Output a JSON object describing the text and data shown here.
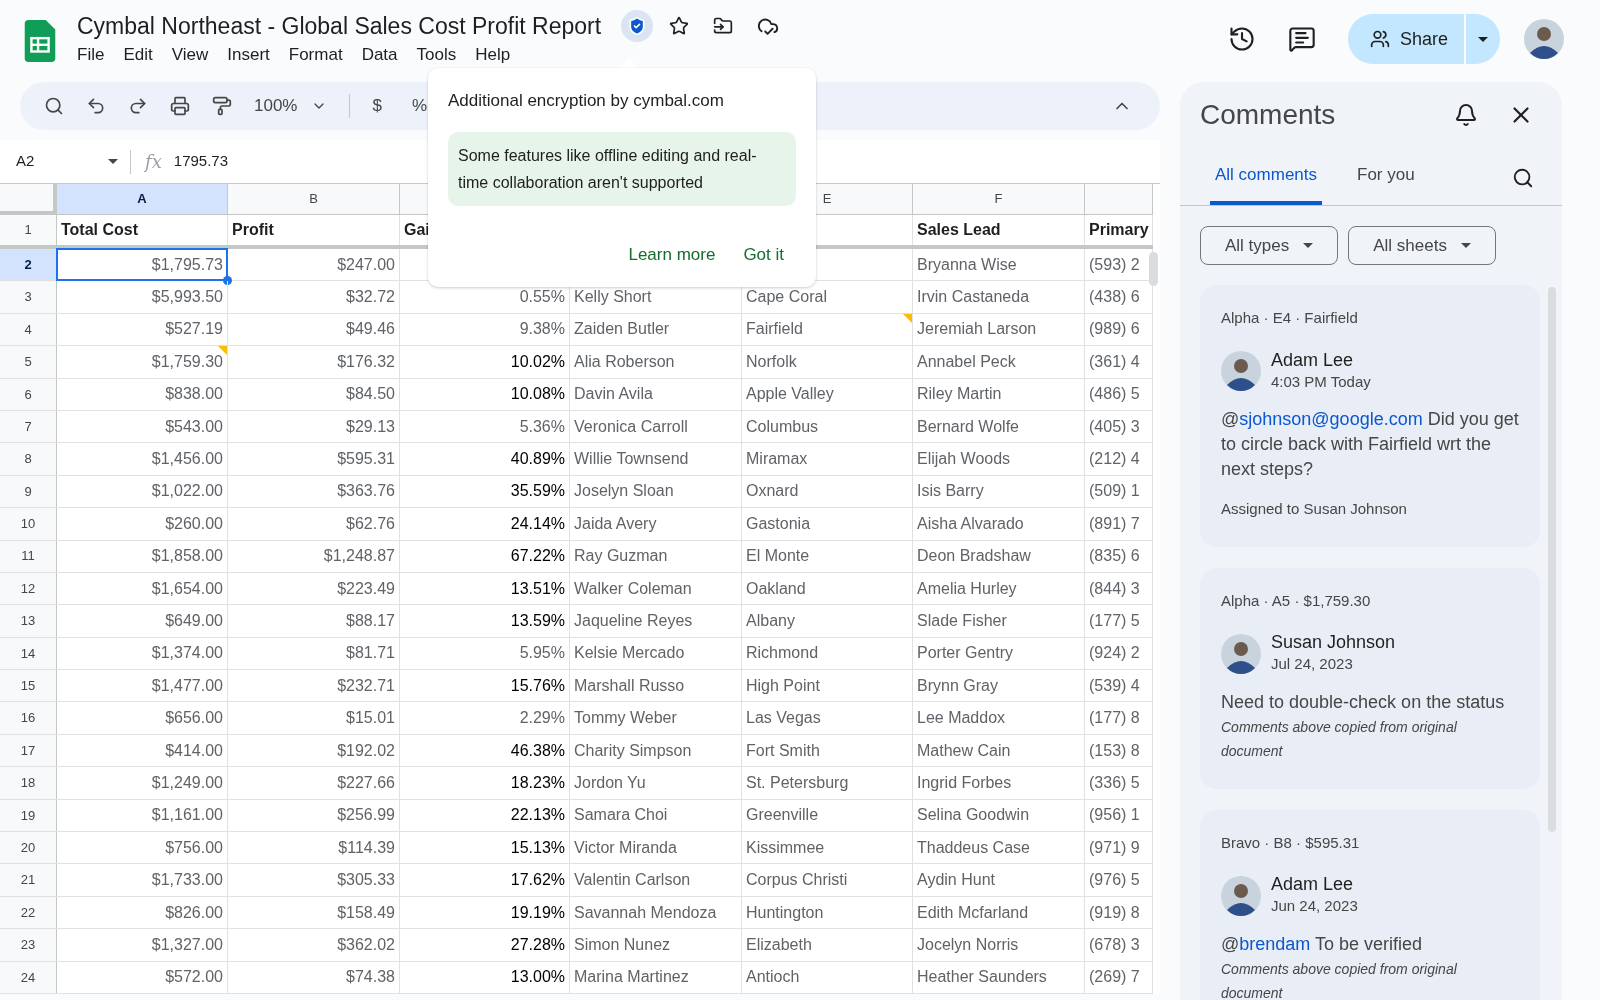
{
  "doc": {
    "title": "Cymbal Northeast - Global Sales Cost Profit Report",
    "menu": [
      "File",
      "Edit",
      "View",
      "Insert",
      "Format",
      "Data",
      "Tools",
      "Help"
    ]
  },
  "toolbar": {
    "zoom": "100%",
    "currency": "$",
    "percent": "%"
  },
  "formula_bar": {
    "cell": "A2",
    "fx": "fx",
    "value": "1795.73"
  },
  "popup": {
    "title": "Additional encryption by cymbal.com",
    "notice": "Some features like offline editing and real-time collaboration aren't supported",
    "actions": [
      "Learn more",
      "Got it"
    ]
  },
  "share": {
    "label": "Share"
  },
  "columns": [
    {
      "letter": "A",
      "selected": true
    },
    {
      "letter": "B",
      "selected": false
    },
    null,
    null,
    {
      "letter": "E",
      "selected": false
    },
    {
      "letter": "F",
      "selected": false
    },
    null
  ],
  "header_row": {
    "num": "1",
    "cells": [
      "Total Cost",
      "Profit",
      "Gai",
      null,
      null,
      "Sales Lead",
      "Primary"
    ]
  },
  "rows": [
    {
      "num": "2",
      "selected": true,
      "dark": false,
      "note_a": false,
      "note_e": false,
      "cells": [
        "$1,795.73",
        "$247.00",
        null,
        null,
        null,
        "Bryanna Wise",
        "(593) 2"
      ]
    },
    {
      "num": "3",
      "selected": false,
      "dark": false,
      "note_a": false,
      "note_e": false,
      "cells": [
        "$5,993.50",
        "$32.72",
        "0.55%",
        "Kelly Short",
        "Cape Coral",
        "Irvin Castaneda",
        "(438) 6"
      ]
    },
    {
      "num": "4",
      "selected": false,
      "dark": false,
      "note_a": false,
      "note_e": true,
      "cells": [
        "$527.19",
        "$49.46",
        "9.38%",
        "Zaiden Butler",
        "Fairfield",
        "Jeremiah Larson",
        "(989) 6"
      ]
    },
    {
      "num": "5",
      "selected": false,
      "dark": true,
      "note_a": true,
      "note_e": false,
      "cells": [
        "$1,759.30",
        "$176.32",
        "10.02%",
        "Alia Roberson",
        "Norfolk",
        "Annabel Peck",
        "(361) 4"
      ]
    },
    {
      "num": "6",
      "selected": false,
      "dark": true,
      "note_a": false,
      "note_e": false,
      "cells": [
        "$838.00",
        "$84.50",
        "10.08%",
        "Davin Avila",
        "Apple Valley",
        "Riley Martin",
        "(486) 5"
      ]
    },
    {
      "num": "7",
      "selected": false,
      "dark": false,
      "note_a": false,
      "note_e": false,
      "cells": [
        "$543.00",
        "$29.13",
        "5.36%",
        "Veronica Carroll",
        "Columbus",
        "Bernard Wolfe",
        "(405) 3"
      ]
    },
    {
      "num": "8",
      "selected": false,
      "dark": true,
      "note_a": false,
      "note_e": false,
      "cells": [
        "$1,456.00",
        "$595.31",
        "40.89%",
        "Willie Townsend",
        "Miramax",
        "Elijah Woods",
        "(212) 4"
      ]
    },
    {
      "num": "9",
      "selected": false,
      "dark": true,
      "note_a": false,
      "note_e": false,
      "cells": [
        "$1,022.00",
        "$363.76",
        "35.59%",
        "Joselyn Sloan",
        "Oxnard",
        "Isis Barry",
        "(509) 1"
      ]
    },
    {
      "num": "10",
      "selected": false,
      "dark": true,
      "note_a": false,
      "note_e": false,
      "cells": [
        "$260.00",
        "$62.76",
        "24.14%",
        "Jaida Avery",
        "Gastonia",
        "Aisha Alvarado",
        "(891) 7"
      ]
    },
    {
      "num": "11",
      "selected": false,
      "dark": true,
      "note_a": false,
      "note_e": false,
      "cells": [
        "$1,858.00",
        "$1,248.87",
        "67.22%",
        "Ray Guzman",
        "El Monte",
        "Deon Bradshaw",
        "(835) 6"
      ]
    },
    {
      "num": "12",
      "selected": false,
      "dark": true,
      "note_a": false,
      "note_e": false,
      "cells": [
        "$1,654.00",
        "$223.49",
        "13.51%",
        "Walker Coleman",
        "Oakland",
        "Amelia Hurley",
        "(844) 3"
      ]
    },
    {
      "num": "13",
      "selected": false,
      "dark": true,
      "note_a": false,
      "note_e": false,
      "cells": [
        "$649.00",
        "$88.17",
        "13.59%",
        "Jaqueline Reyes",
        "Albany",
        "Slade Fisher",
        "(177) 5"
      ]
    },
    {
      "num": "14",
      "selected": false,
      "dark": false,
      "note_a": false,
      "note_e": false,
      "cells": [
        "$1,374.00",
        "$81.71",
        "5.95%",
        "Kelsie Mercado",
        "Richmond",
        "Porter Gentry",
        "(924) 2"
      ]
    },
    {
      "num": "15",
      "selected": false,
      "dark": true,
      "note_a": false,
      "note_e": false,
      "cells": [
        "$1,477.00",
        "$232.71",
        "15.76%",
        "Marshall Russo",
        "High Point",
        "Brynn Gray",
        "(539) 4"
      ]
    },
    {
      "num": "16",
      "selected": false,
      "dark": false,
      "note_a": false,
      "note_e": false,
      "cells": [
        "$656.00",
        "$15.01",
        "2.29%",
        "Tommy Weber",
        "Las Vegas",
        "Lee Maddox",
        "(177) 8"
      ]
    },
    {
      "num": "17",
      "selected": false,
      "dark": true,
      "note_a": false,
      "note_e": false,
      "cells": [
        "$414.00",
        "$192.02",
        "46.38%",
        "Charity Simpson",
        "Fort Smith",
        "Mathew Cain",
        "(153) 8"
      ]
    },
    {
      "num": "18",
      "selected": false,
      "dark": true,
      "note_a": false,
      "note_e": false,
      "cells": [
        "$1,249.00",
        "$227.66",
        "18.23%",
        "Jordon Yu",
        "St. Petersburg",
        "Ingrid Forbes",
        "(336) 5"
      ]
    },
    {
      "num": "19",
      "selected": false,
      "dark": true,
      "note_a": false,
      "note_e": false,
      "cells": [
        "$1,161.00",
        "$256.99",
        "22.13%",
        "Samara Choi",
        "Greenville",
        "Selina Goodwin",
        "(956) 1"
      ]
    },
    {
      "num": "20",
      "selected": false,
      "dark": true,
      "note_a": false,
      "note_e": false,
      "cells": [
        "$756.00",
        "$114.39",
        "15.13%",
        "Victor Miranda",
        "Kissimmee",
        "Thaddeus Case",
        "(971) 9"
      ]
    },
    {
      "num": "21",
      "selected": false,
      "dark": true,
      "note_a": false,
      "note_e": false,
      "cells": [
        "$1,733.00",
        "$305.33",
        "17.62%",
        "Valentin Carlson",
        "Corpus Christi",
        "Aydin Hunt",
        "(976) 5"
      ]
    },
    {
      "num": "22",
      "selected": false,
      "dark": true,
      "note_a": false,
      "note_e": false,
      "cells": [
        "$826.00",
        "$158.49",
        "19.19%",
        "Savannah Mendoza",
        "Huntington",
        "Edith Mcfarland",
        "(919) 8"
      ]
    },
    {
      "num": "23",
      "selected": false,
      "dark": true,
      "note_a": false,
      "note_e": false,
      "cells": [
        "$1,327.00",
        "$362.02",
        "27.28%",
        "Simon Nunez",
        "Elizabeth",
        "Jocelyn Norris",
        "(678) 3"
      ]
    },
    {
      "num": "24",
      "selected": false,
      "dark": true,
      "note_a": false,
      "note_e": false,
      "cells": [
        "$572.00",
        "$74.38",
        "13.00%",
        "Marina Martinez",
        "Antioch",
        "Heather Saunders",
        "(269) 7"
      ]
    }
  ],
  "comments_panel": {
    "title": "Comments",
    "tabs": [
      {
        "label": "All comments",
        "selected": true
      },
      {
        "label": "For you",
        "selected": false
      }
    ],
    "filters": [
      "All types",
      "All sheets"
    ],
    "cards": [
      {
        "context": "Alpha · E4 · Fairfield",
        "author": "Adam Lee",
        "time": "4:03 PM Today",
        "prefix": "@",
        "mention": "sjohnson@google.com",
        "text": " Did you get to circle back with Fairfield wrt the next steps?",
        "footer": "Assigned to Susan Johnson",
        "kind": "assigned"
      },
      {
        "context": "Alpha · A5 · $1,759.30",
        "author": "Susan Johnson",
        "time": "Jul 24, 2023",
        "text": "Need to double-check on the status",
        "footer": "Comments above copied from original document",
        "kind": "copied"
      },
      {
        "context": "Bravo · B8 · $595.31",
        "author": "Adam Lee",
        "time": "Jun 24, 2023",
        "prefix": "@",
        "mention": "brendam",
        "text": " To be verified",
        "footer": "Comments above copied from original document",
        "kind": "copied"
      }
    ]
  }
}
